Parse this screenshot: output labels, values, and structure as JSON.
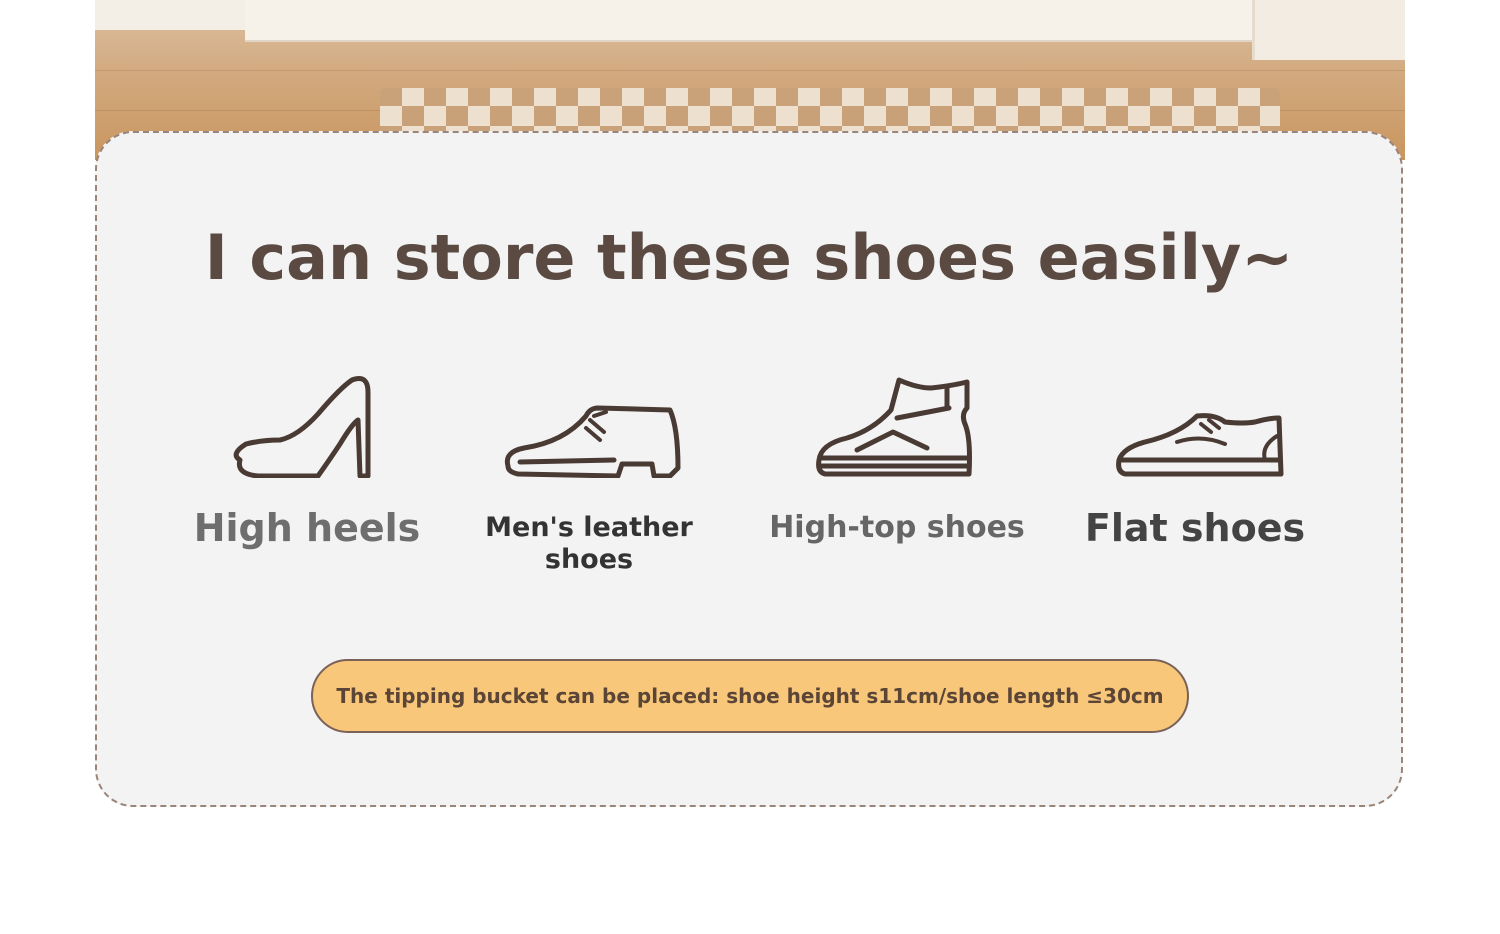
{
  "heading": "I can store these shoes easily~",
  "shoes": [
    {
      "icon": "high-heel-icon",
      "label": "High heels",
      "color": "#6e6e6e"
    },
    {
      "icon": "leather-shoe-icon",
      "label": "Men's leather shoes",
      "color": "#333333"
    },
    {
      "icon": "high-top-shoe-icon",
      "label": "High-top shoes",
      "color": "#666666"
    },
    {
      "icon": "flat-shoe-icon",
      "label": "Flat shoes",
      "color": "#444444"
    }
  ],
  "note": "The tipping bucket can be placed: shoe height s11cm/shoe length ≤30cm",
  "colors": {
    "card_bg": "#f3f3f3",
    "card_border": "#9a857a",
    "heading": "#5a4a42",
    "note_bg": "#f8c77a",
    "icon_stroke": "#4a3a34"
  }
}
